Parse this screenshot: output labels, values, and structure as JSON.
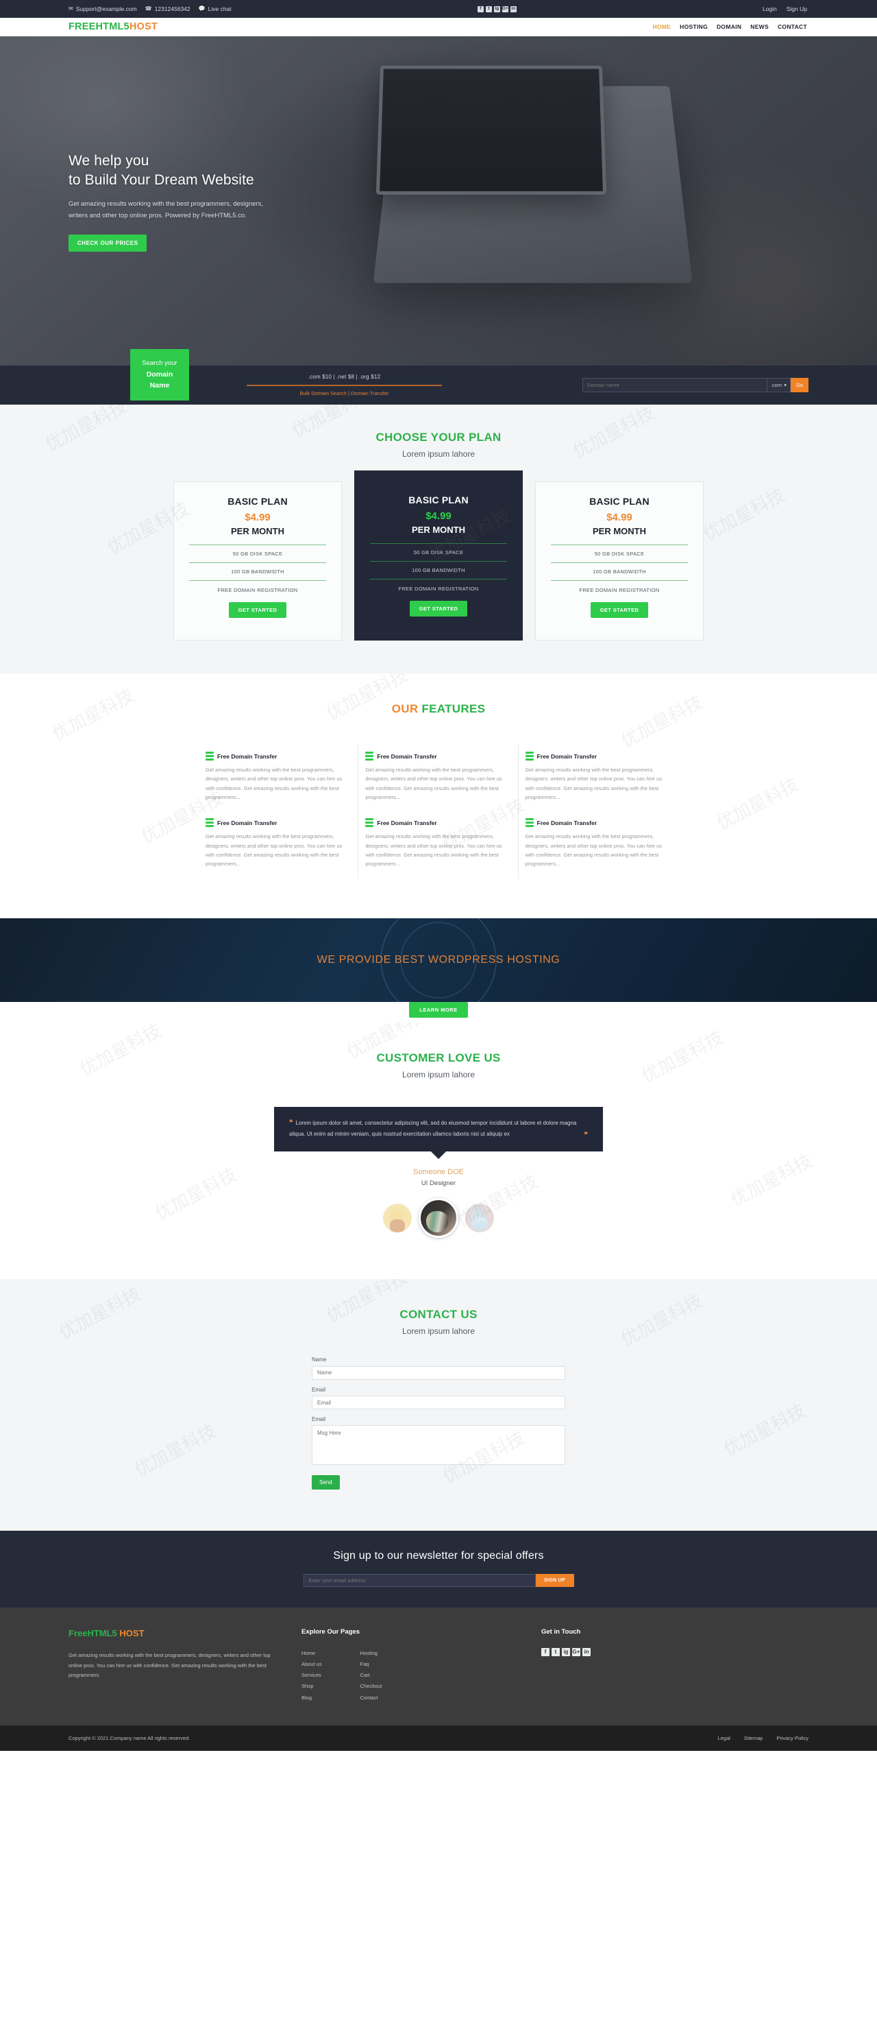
{
  "topbar": {
    "email": "Support@example.com",
    "phone": "12312456342",
    "livechat": "Live chat",
    "socials": [
      "f",
      "t",
      "ig",
      "G+",
      "in"
    ],
    "login": "Login",
    "signup": "Sign Up"
  },
  "nav": {
    "logo_green": "FREEHTML5",
    "logo_orange": "HOST",
    "links": [
      {
        "label": "HOME",
        "active": true
      },
      {
        "label": "HOSTING",
        "active": false
      },
      {
        "label": "DOMAIN",
        "active": false
      },
      {
        "label": "NEWS",
        "active": false
      },
      {
        "label": "CONTACT",
        "active": false
      }
    ]
  },
  "hero": {
    "title_line1": "We help you",
    "title_line2": "to Build Your Dream Website",
    "paragraph": "Get amazing results working with the best programmers, designers, writers and other top online pros. Powered by FreeHTML5.co.",
    "cta": "CHECK OUR PRICES"
  },
  "domain_search": {
    "badge_line1": "Search your",
    "badge_line2": "Domain",
    "badge_line3": "Name",
    "prices": ".com $10 | .net $8 | .org $12",
    "links": "Bulk Domain Search | Domain Transfer",
    "input_placeholder": "Domain name",
    "tld_selected": ".com",
    "go_label": "Go"
  },
  "plans_section": {
    "title_green": "CHOOSE YOUR PLAN",
    "subtitle": "Lorem ipsum lahore",
    "plans": [
      {
        "name": "BASIC PLAN",
        "price": "$4.99",
        "per": "PER MONTH",
        "feat1": "50 GB DISK SPACE",
        "feat2": "100 GB BANDWIDTH",
        "feat3": "FREE DOMAIN REGISTRATION",
        "button": "GET STARTED"
      },
      {
        "name": "BASIC PLAN",
        "price": "$4.99",
        "per": "PER MONTH",
        "feat1": "50 GB DISK SPACE",
        "feat2": "100 GB BANDWIDTH",
        "feat3": "FREE DOMAIN REGISTRATION",
        "button": "GET STARTED"
      },
      {
        "name": "BASIC PLAN",
        "price": "$4.99",
        "per": "PER MONTH",
        "feat1": "50 GB DISK SPACE",
        "feat2": "100 GB BANDWIDTH",
        "feat3": "FREE DOMAIN REGISTRATION",
        "button": "GET STARTED"
      }
    ]
  },
  "features_section": {
    "title_orange": "OUR",
    "title_green": "FEATURES",
    "items": [
      {
        "title": "Free Domain Transfer",
        "body": "Get amazing results working with the best programmers, designers, writers and other top online pros. You can hire us with confidence. Get amazing results working with the best programmers..."
      },
      {
        "title": "Free Domain Transfer",
        "body": "Get amazing results working with the best programmers, designers, writers and other top online pros. You can hire us with confidence. Get amazing results working with the best programmers..."
      },
      {
        "title": "Free Domain Transfer",
        "body": "Get amazing results working with the best programmers, designers, writers and other top online pros. You can hire us with confidence. Get amazing results working with the best programmers..."
      },
      {
        "title": "Free Domain Transfer",
        "body": "Get amazing results working with the best programmers, designers, writers and other top online pros. You can hire us with confidence. Get amazing results working with the best programmers..."
      },
      {
        "title": "Free Domain Transfer",
        "body": "Get amazing results working with the best programmers, designers, writers and other top online pros. You can hire us with confidence. Get amazing results working with the best programmers..."
      },
      {
        "title": "Free Domain Transfer",
        "body": "Get amazing results working with the best programmers, designers, writers and other top online pros. You can hire us with confidence. Get amazing results working with the best programmers..."
      }
    ]
  },
  "wordpress_banner": {
    "title": "WE PROVIDE BEST WORDPRESS HOSTING",
    "button": "LEARN MORE"
  },
  "testimonial_section": {
    "title": "CUSTOMER LOVE US",
    "subtitle": "Lorem ipsum lahore",
    "quote": "Lorem ipsum dolor sit amet, consectetur adipiscing elit, sed do eiusmod tempor incididunt ut labore et dolore magna aliqua. Ut enim ad minim veniam, quis nostrud exercitation ullamco laboris nisi ut aliquip ex",
    "name": "Someone DOE",
    "role": "UI Designer"
  },
  "contact_section": {
    "title": "CONTACT US",
    "subtitle": "Lorem ipsum lahore",
    "label_name": "Name",
    "placeholder_name": "Name",
    "label_email": "Email",
    "placeholder_email": "Email",
    "label_message": "Email",
    "placeholder_message": "Msg Here",
    "send_label": "Send"
  },
  "newsletter": {
    "title": "Sign up to our newsletter for special offers",
    "placeholder": "Enter your email address",
    "button": "SIGN UP"
  },
  "footer": {
    "logo_green": "FreeHTML5",
    "logo_orange": "HOST",
    "about": "Get amazing results working with the best programmers, designers, writers and other top online pros. You can hire us with confidence. Get amazing results working with the best programmers",
    "explore_head": "Explore Our Pages",
    "links_col_a": [
      "Home",
      "About us",
      "Services",
      "Shop",
      "Blog"
    ],
    "links_col_b": [
      "Hosting",
      "Faq",
      "Cart",
      "Checkout",
      "Contact"
    ],
    "touch_head": "Get in Touch",
    "socials": [
      "f",
      "t",
      "ig",
      "G+",
      "in"
    ],
    "copyright": "Copyright © 2021.Company name All rights reserved.",
    "legal_links": [
      "Legal",
      "Sitemap",
      "Privacy Policy"
    ]
  },
  "colors": {
    "green": "#2ecc4a",
    "orange": "#f08228",
    "dark": "#262b3a",
    "footer_dark": "#3c3c3c"
  }
}
